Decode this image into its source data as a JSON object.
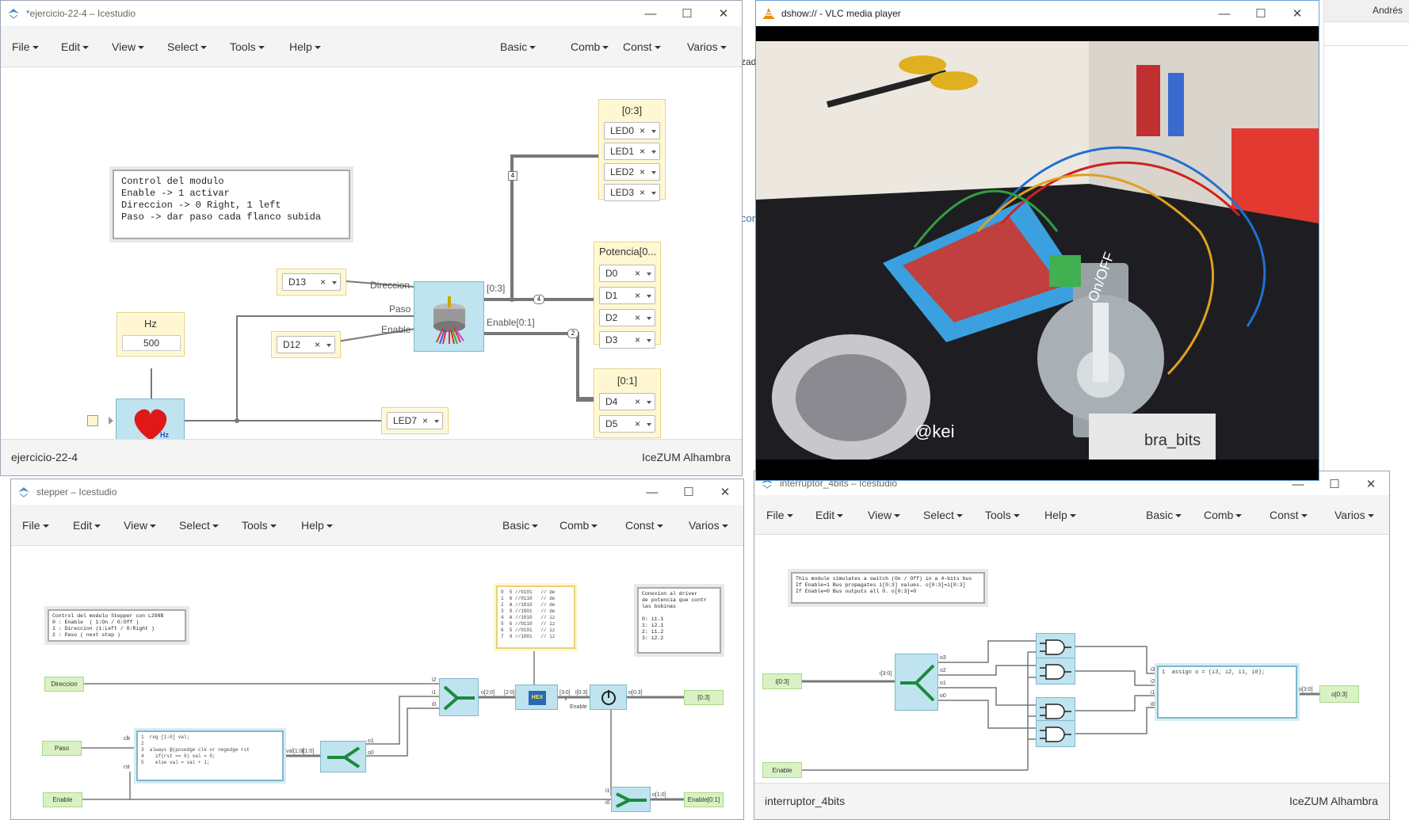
{
  "desktop": {
    "username": "Andrés",
    "side_fragment_1": "zad",
    "side_fragment_2": "cor"
  },
  "icestudio_menu": [
    "File",
    "Edit",
    "View",
    "Select",
    "Tools",
    "Help"
  ],
  "icestudio_right_menu": [
    "Basic",
    "Comb",
    "Const",
    "Varios"
  ],
  "win1": {
    "title": "*ejercicio-22-4 – Icestudio",
    "footer_left": "ejercicio-22-4",
    "footer_right": "IceZUM Alhambra",
    "note": "Control del modulo\nEnable -> 1 activar\nDireccion -> 0 Right, 1 left\nPaso -> dar paso cada flanco subida",
    "hz_title": "Hz",
    "hz_value": "500",
    "led_group_title": "[0:3]",
    "leds": [
      "LED0",
      "LED1",
      "LED2",
      "LED3"
    ],
    "pot_title": "Potencia[0...",
    "pot_pins": [
      "D0",
      "D1",
      "D2",
      "D3"
    ],
    "en_title": "[0:1]",
    "en_pins": [
      "D4",
      "D5"
    ],
    "pin_d13": "D13",
    "pin_d12": "D12",
    "pin_led7": "LED7",
    "label_direccion": "Direccion",
    "label_paso": "Paso",
    "label_enable": "Enable",
    "label_out03": "[0:3]",
    "label_enable01": "Enable[0:1]",
    "bus_4a": "4",
    "bus_4b": "4",
    "bus_2": "2",
    "heart_label": "Hz"
  },
  "vlc": {
    "title": "dshow:// - VLC media player",
    "video_text_1": "@kei",
    "video_text_2": "bra_bits",
    "video_text_3": "On/OFF"
  },
  "win2": {
    "title": "stepper – Icestudio",
    "note": "Control del modulo Stepper con L298B\n0 : Enable  ( 1:On / 0:Off )\n1 : Direccion (1:Left / 0:Right )\n2 : Paso ( next step )",
    "note2": "Conexion al driver\nde potencia que contr\nlas bobinas\n\n0: i1.1\n1: i2.1\n2: i1.2\n3: i2.2",
    "rom_code": "0  5 //0101   // de\n1  6 //0110   // de\n2  A //1010   // de\n3  9 //1001   // de\n4  A //1010   // iz\n5  6 //0110   // iz\n6  5 //0101   // iz\n7  9 //1001   // iz",
    "counter_code": "1  reg [1:0] val;\n2\n3  always @(posedge clk or negedge rst\n4    if(rst == 0) val = 0;\n5    else val = val + 1;",
    "in_direccion": "Direccion",
    "in_paso": "Paso",
    "in_enable": "Enable",
    "out_03": "[0:3]",
    "out_enable01": "Enable[0:1]",
    "lbl_clk": "clk",
    "lbl_rst": "rst",
    "lbl_val": "val[1:0]",
    "lbl_i10": "i[1:0]",
    "lbl_o1": "o1",
    "lbl_o0": "o0",
    "lbl_i2": "i2",
    "lbl_i1": "i1",
    "lbl_i0": "i0",
    "lbl_o20": "o[2:0]",
    "lbl_2_0": "[2:0]",
    "lbl_3_0": "[3:0]",
    "lbl_i03": "i[0:3]",
    "lbl_enable": "Enable",
    "lbl_o03": "o[0:3]",
    "lbl_o10": "o[1:0]",
    "lbl_wi1": "i1",
    "lbl_wi0": "i0",
    "rom_label": "HEX",
    "footer_left": "",
    "footer_right": ""
  },
  "win3": {
    "title": "interruptor_4bits – Icestudio",
    "footer_left": "interruptor_4bits",
    "footer_right": "IceZUM Alhambra",
    "note": "This module simulates a switch (On / Off) in a 4-bits bus\nIf Enable=1 Bus propagates i[0:3] values. o[0:3]=i[0:3]\nIf Enable=0 Bus outputs all 0. o[0:3]=0",
    "code": "1  assign o = {i3, i2, i1, i0};",
    "in_i03": "i[0:3]",
    "in_enable": "Enable",
    "out_o03": "o[0:3]",
    "lbl_i30": "i[3:0]",
    "lbl_o3": "o3",
    "lbl_o2": "o2",
    "lbl_o1": "o1",
    "lbl_o0": "o0",
    "lbl_i3": "i3",
    "lbl_i2": "i2",
    "lbl_i1": "i1",
    "lbl_i0": "i0",
    "lbl_o30": "o[3:0]"
  }
}
